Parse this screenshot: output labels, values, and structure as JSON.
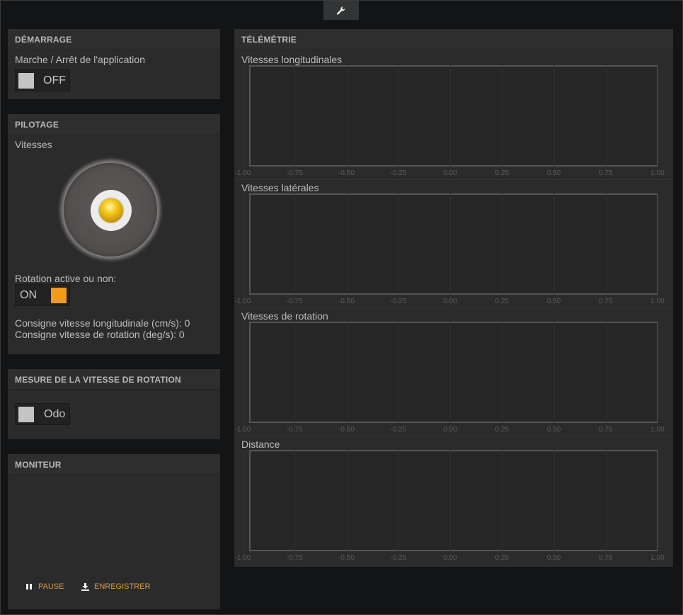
{
  "top_tab": {
    "icon": "wrench-icon"
  },
  "demarrage": {
    "title": "DÉMARRAGE",
    "label": "Marche / Arrêt de l'application",
    "toggle_text": "OFF"
  },
  "pilotage": {
    "title": "PILOTAGE",
    "vitesses_label": "Vitesses",
    "rotation_label": "Rotation active ou non:",
    "rotation_toggle_text": "ON",
    "consigne_long": "Consigne vitesse longitudinale (cm/s): 0",
    "consigne_rot": "Consigne vitesse de rotation (deg/s): 0"
  },
  "mesure": {
    "title": "MESURE DE LA VITESSE DE ROTATION",
    "toggle_text": "Odo"
  },
  "moniteur": {
    "title": "MONITEUR",
    "pause_label": "PAUSE",
    "save_label": "ENREGISTRER"
  },
  "telemetrie": {
    "title": "TÉLÉMÉTRIE",
    "graphs": [
      {
        "label": "Vitesses longitudinales"
      },
      {
        "label": "Vitesses latérales"
      },
      {
        "label": "Vitesses de rotation"
      },
      {
        "label": "Distance"
      }
    ],
    "x_ticks": [
      "-1.00",
      "-0.75",
      "-0.50",
      "-0.25",
      "0.00",
      "0.25",
      "0.50",
      "0.75",
      "1.00"
    ]
  },
  "colors": {
    "accent_orange": "#f19a1b",
    "panel_bg": "#2b2b2b",
    "page_bg": "#131416"
  }
}
